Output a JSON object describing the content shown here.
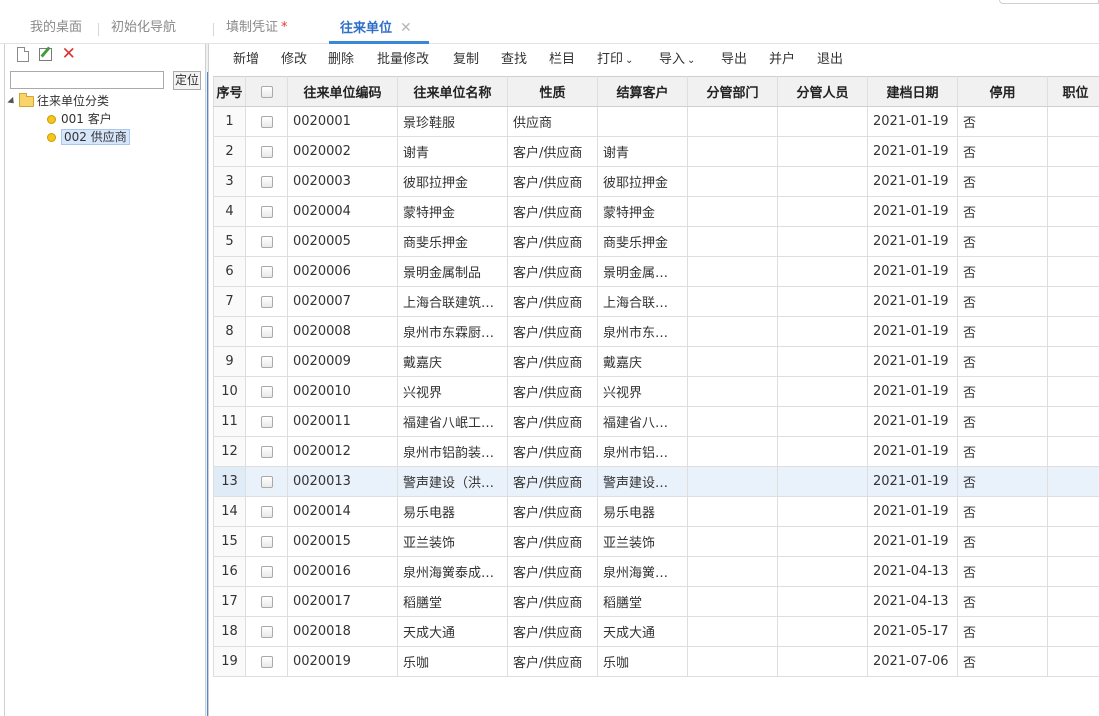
{
  "tabs": [
    {
      "label": "我的桌面",
      "modified": false,
      "active": false
    },
    {
      "label": "初始化导航",
      "modified": false,
      "active": false
    },
    {
      "label": "填制凭证",
      "modified": true,
      "active": false
    },
    {
      "label": "往来单位",
      "modified": false,
      "active": true
    }
  ],
  "tab_modified_mark": "*",
  "tab_close_glyph": "✕",
  "left_panel": {
    "toolbar_icons": [
      "new-doc-icon",
      "edit-icon",
      "delete-icon"
    ],
    "search_value": "",
    "locate_label": "定位",
    "tree": {
      "root": "往来单位分类",
      "children": [
        {
          "label": "001 客户",
          "selected": false
        },
        {
          "label": "002 供应商",
          "selected": true
        }
      ]
    }
  },
  "toolbar": {
    "add": "新增",
    "edit": "修改",
    "delete": "删除",
    "batch_edit": "批量修改",
    "copy": "复制",
    "find": "查找",
    "columns": "栏目",
    "print": "打印",
    "import": "导入",
    "export": "导出",
    "merge": "并户",
    "exit": "退出",
    "dropdown_caret": "⌄"
  },
  "grid": {
    "headers": [
      "序号",
      "",
      "往来单位编码",
      "往来单位名称",
      "性质",
      "结算客户",
      "分管部门",
      "分管人员",
      "建档日期",
      "停用",
      "职位"
    ],
    "highlight_row": 13,
    "rows": [
      [
        "1",
        "0020001",
        "景珍鞋服",
        "供应商",
        "",
        "",
        "",
        "2021-01-19",
        "否"
      ],
      [
        "2",
        "0020002",
        "谢青",
        "客户/供应商",
        "谢青",
        "",
        "",
        "2021-01-19",
        "否"
      ],
      [
        "3",
        "0020003",
        "彼耶拉押金",
        "客户/供应商",
        "彼耶拉押金",
        "",
        "",
        "2021-01-19",
        "否"
      ],
      [
        "4",
        "0020004",
        "蒙特押金",
        "客户/供应商",
        "蒙特押金",
        "",
        "",
        "2021-01-19",
        "否"
      ],
      [
        "5",
        "0020005",
        "商斐乐押金",
        "客户/供应商",
        "商斐乐押金",
        "",
        "",
        "2021-01-19",
        "否"
      ],
      [
        "6",
        "0020006",
        "景明金属制品",
        "客户/供应商",
        "景明金属…",
        "",
        "",
        "2021-01-19",
        "否"
      ],
      [
        "7",
        "0020007",
        "上海合联建筑…",
        "客户/供应商",
        "上海合联…",
        "",
        "",
        "2021-01-19",
        "否"
      ],
      [
        "8",
        "0020008",
        "泉州市东霖厨…",
        "客户/供应商",
        "泉州市东…",
        "",
        "",
        "2021-01-19",
        "否"
      ],
      [
        "9",
        "0020009",
        "戴嘉庆",
        "客户/供应商",
        "戴嘉庆",
        "",
        "",
        "2021-01-19",
        "否"
      ],
      [
        "10",
        "0020010",
        "兴视界",
        "客户/供应商",
        "兴视界",
        "",
        "",
        "2021-01-19",
        "否"
      ],
      [
        "11",
        "0020011",
        "福建省八岷工…",
        "客户/供应商",
        "福建省八…",
        "",
        "",
        "2021-01-19",
        "否"
      ],
      [
        "12",
        "0020012",
        "泉州市铝韵装…",
        "客户/供应商",
        "泉州市铝…",
        "",
        "",
        "2021-01-19",
        "否"
      ],
      [
        "13",
        "0020013",
        "警声建设（洪…",
        "客户/供应商",
        "警声建设…",
        "",
        "",
        "2021-01-19",
        "否"
      ],
      [
        "14",
        "0020014",
        "易乐电器",
        "客户/供应商",
        "易乐电器",
        "",
        "",
        "2021-01-19",
        "否"
      ],
      [
        "15",
        "0020015",
        "亚兰装饰",
        "客户/供应商",
        "亚兰装饰",
        "",
        "",
        "2021-01-19",
        "否"
      ],
      [
        "16",
        "0020016",
        "泉州海黉泰成…",
        "客户/供应商",
        "泉州海黉…",
        "",
        "",
        "2021-04-13",
        "否"
      ],
      [
        "17",
        "0020017",
        "稻膳堂",
        "客户/供应商",
        "稻膳堂",
        "",
        "",
        "2021-04-13",
        "否"
      ],
      [
        "18",
        "0020018",
        "天成大通",
        "客户/供应商",
        "天成大通",
        "",
        "",
        "2021-05-17",
        "否"
      ],
      [
        "19",
        "0020019",
        "乐咖",
        "客户/供应商",
        "乐咖",
        "",
        "",
        "2021-07-06",
        "否"
      ]
    ]
  }
}
